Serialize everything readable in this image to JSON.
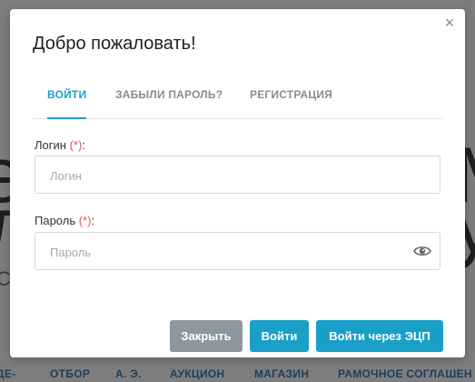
{
  "background": {
    "big_text_1": "е",
    "big_text_2": "л",
    "big_text_3": "М",
    "big_text_4": "у",
    "side_text": "С",
    "nav_items": [
      "ДЕ-",
      "ОТБОР",
      "А. Э.",
      "АУКЦИОН",
      "МАГАЗИН",
      "РАМОЧНОЕ СОГЛАШЕН"
    ]
  },
  "modal": {
    "title": "Добро пожаловать!",
    "close_symbol": "×",
    "tabs": [
      {
        "label": "ВОЙТИ",
        "active": true
      },
      {
        "label": "ЗАБЫЛИ ПАРОЛЬ?",
        "active": false
      },
      {
        "label": "РЕГИСТРАЦИЯ",
        "active": false
      }
    ],
    "login": {
      "label": "Логин ",
      "required_mark": "(*)",
      "suffix": ":",
      "placeholder": "Логин",
      "value": ""
    },
    "password": {
      "label": "Пароль ",
      "required_mark": "(*)",
      "suffix": ":",
      "placeholder": "Пароль",
      "value": ""
    },
    "buttons": {
      "close": "Закрыть",
      "login": "Войти",
      "login_ecp": "Войти через ЭЦП"
    }
  },
  "colors": {
    "accent": "#1aa0c8",
    "secondary_button": "#8e97a0",
    "required": "#d9534f",
    "overlay": "#7d7d7d"
  },
  "icons": {
    "close": "close-icon",
    "eye": "eye-icon"
  }
}
